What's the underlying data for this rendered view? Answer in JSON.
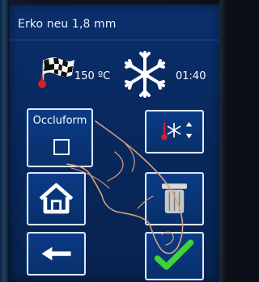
{
  "screen": {
    "title": "Erko neu 1,8 mm"
  },
  "status": {
    "temperature": "150 ºC",
    "time": "01:40",
    "flag_icon": "checkered-flag-icon",
    "cooling_icon": "snowflake-icon"
  },
  "buttons": {
    "occluform_label": "Occluform",
    "occluform_checked": false,
    "home_icon": "home-icon",
    "back_icon": "arrow-left-icon",
    "cooling_settings_icon": "thermometer-snowflake-updown-icon",
    "trash_icon": "trash-icon",
    "confirm_icon": "checkmark-icon"
  },
  "colors": {
    "screen_bg": "#0b2f6c",
    "button_border": "#d9e6ff",
    "text": "#ffffff",
    "accent_red": "#d91d2b",
    "accent_green": "#41d23a"
  }
}
